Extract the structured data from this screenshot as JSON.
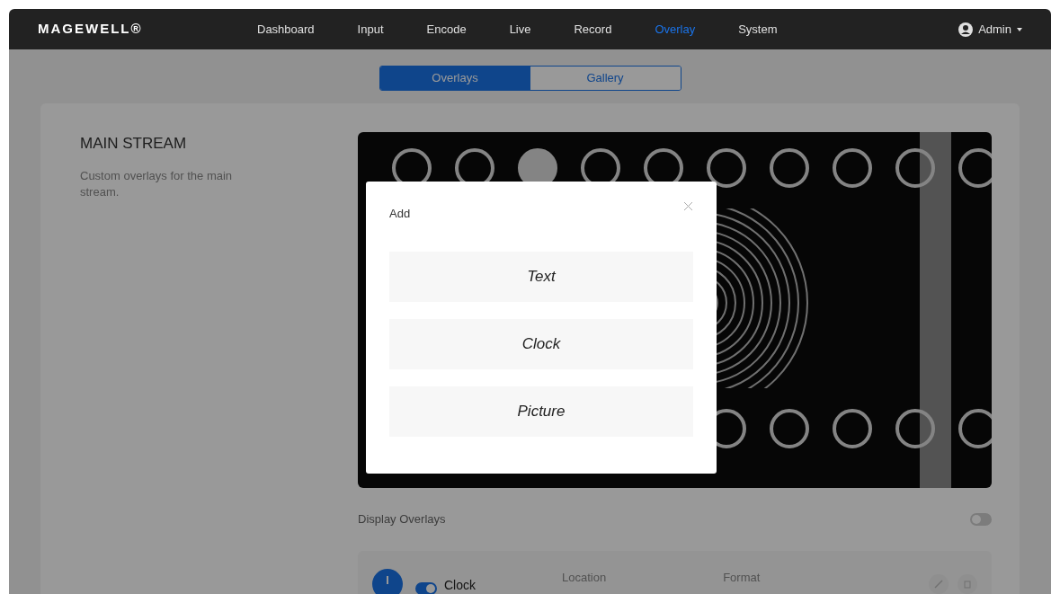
{
  "nav": {
    "logo": "MAGEWELL®",
    "items": [
      {
        "label": "Dashboard",
        "selected": false
      },
      {
        "label": "Input",
        "selected": false
      },
      {
        "label": "Encode",
        "selected": false
      },
      {
        "label": "Live",
        "selected": false
      },
      {
        "label": "Record",
        "selected": false
      },
      {
        "label": "Overlay",
        "selected": true
      },
      {
        "label": "System",
        "selected": false
      }
    ],
    "user": "Admin"
  },
  "tabs": [
    {
      "label": "Overlays",
      "selected": true
    },
    {
      "label": "Gallery",
      "selected": false
    }
  ],
  "section": {
    "title": "MAIN STREAM",
    "description": "Custom overlays for the main stream."
  },
  "display_overlays": {
    "label": "Display Overlays",
    "on": false
  },
  "overlay_items": [
    {
      "name": "Clock",
      "enabled": true,
      "columns": [
        "Location",
        "Format"
      ]
    }
  ],
  "dialog": {
    "title": "Add",
    "options": [
      "Text",
      "Clock",
      "Picture"
    ]
  }
}
